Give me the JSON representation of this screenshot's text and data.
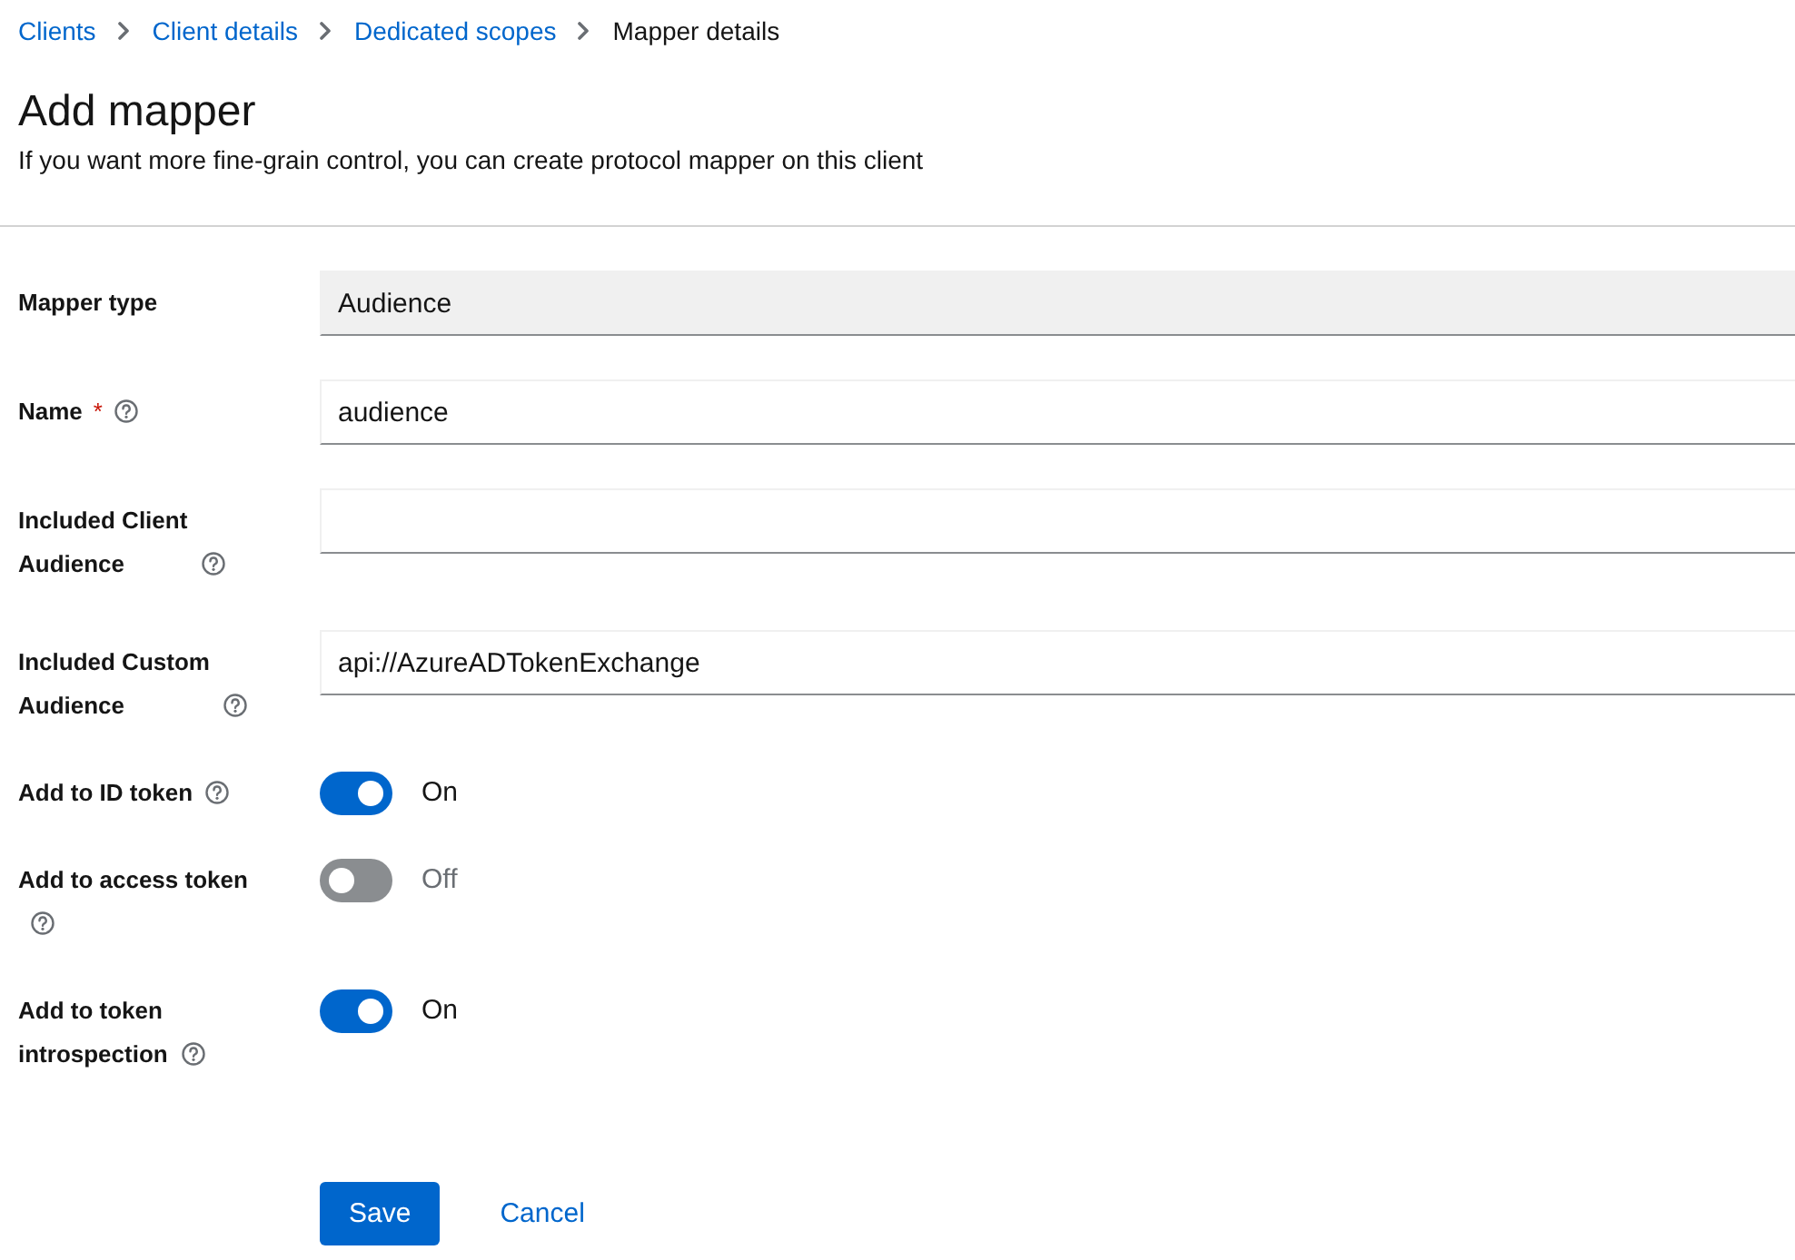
{
  "breadcrumb": [
    {
      "label": "Clients",
      "current": false
    },
    {
      "label": "Client details",
      "current": false
    },
    {
      "label": "Dedicated scopes",
      "current": false
    },
    {
      "label": "Mapper details",
      "current": true
    }
  ],
  "header": {
    "title": "Add mapper",
    "description": "If you want more fine-grain control, you can create protocol mapper on this client"
  },
  "form": {
    "fields": [
      {
        "kind": "text",
        "label": "Mapper type",
        "help": false,
        "readonly": true,
        "value": "Audience"
      },
      {
        "kind": "text",
        "label": "Name",
        "required_mark": "*",
        "help": true,
        "readonly": false,
        "value": "audience"
      },
      {
        "kind": "text",
        "label": "Included Client Audience",
        "help": true,
        "readonly": false
      },
      {
        "kind": "text",
        "label": "Included Custom Audience",
        "help": true,
        "readonly": false,
        "value": "api://AzureADTokenExchange"
      },
      {
        "kind": "switch",
        "label": "Add to ID token",
        "help": true,
        "on": true,
        "status": "On"
      },
      {
        "kind": "switch",
        "label": "Add to access token",
        "help": true,
        "on": false,
        "status": "Off"
      },
      {
        "kind": "switch",
        "label": "Add to token introspection",
        "help": true,
        "on": true,
        "status": "On"
      }
    ],
    "actions": [
      {
        "kind": "primary",
        "label": "Save"
      },
      {
        "kind": "link",
        "label": "Cancel"
      }
    ]
  }
}
